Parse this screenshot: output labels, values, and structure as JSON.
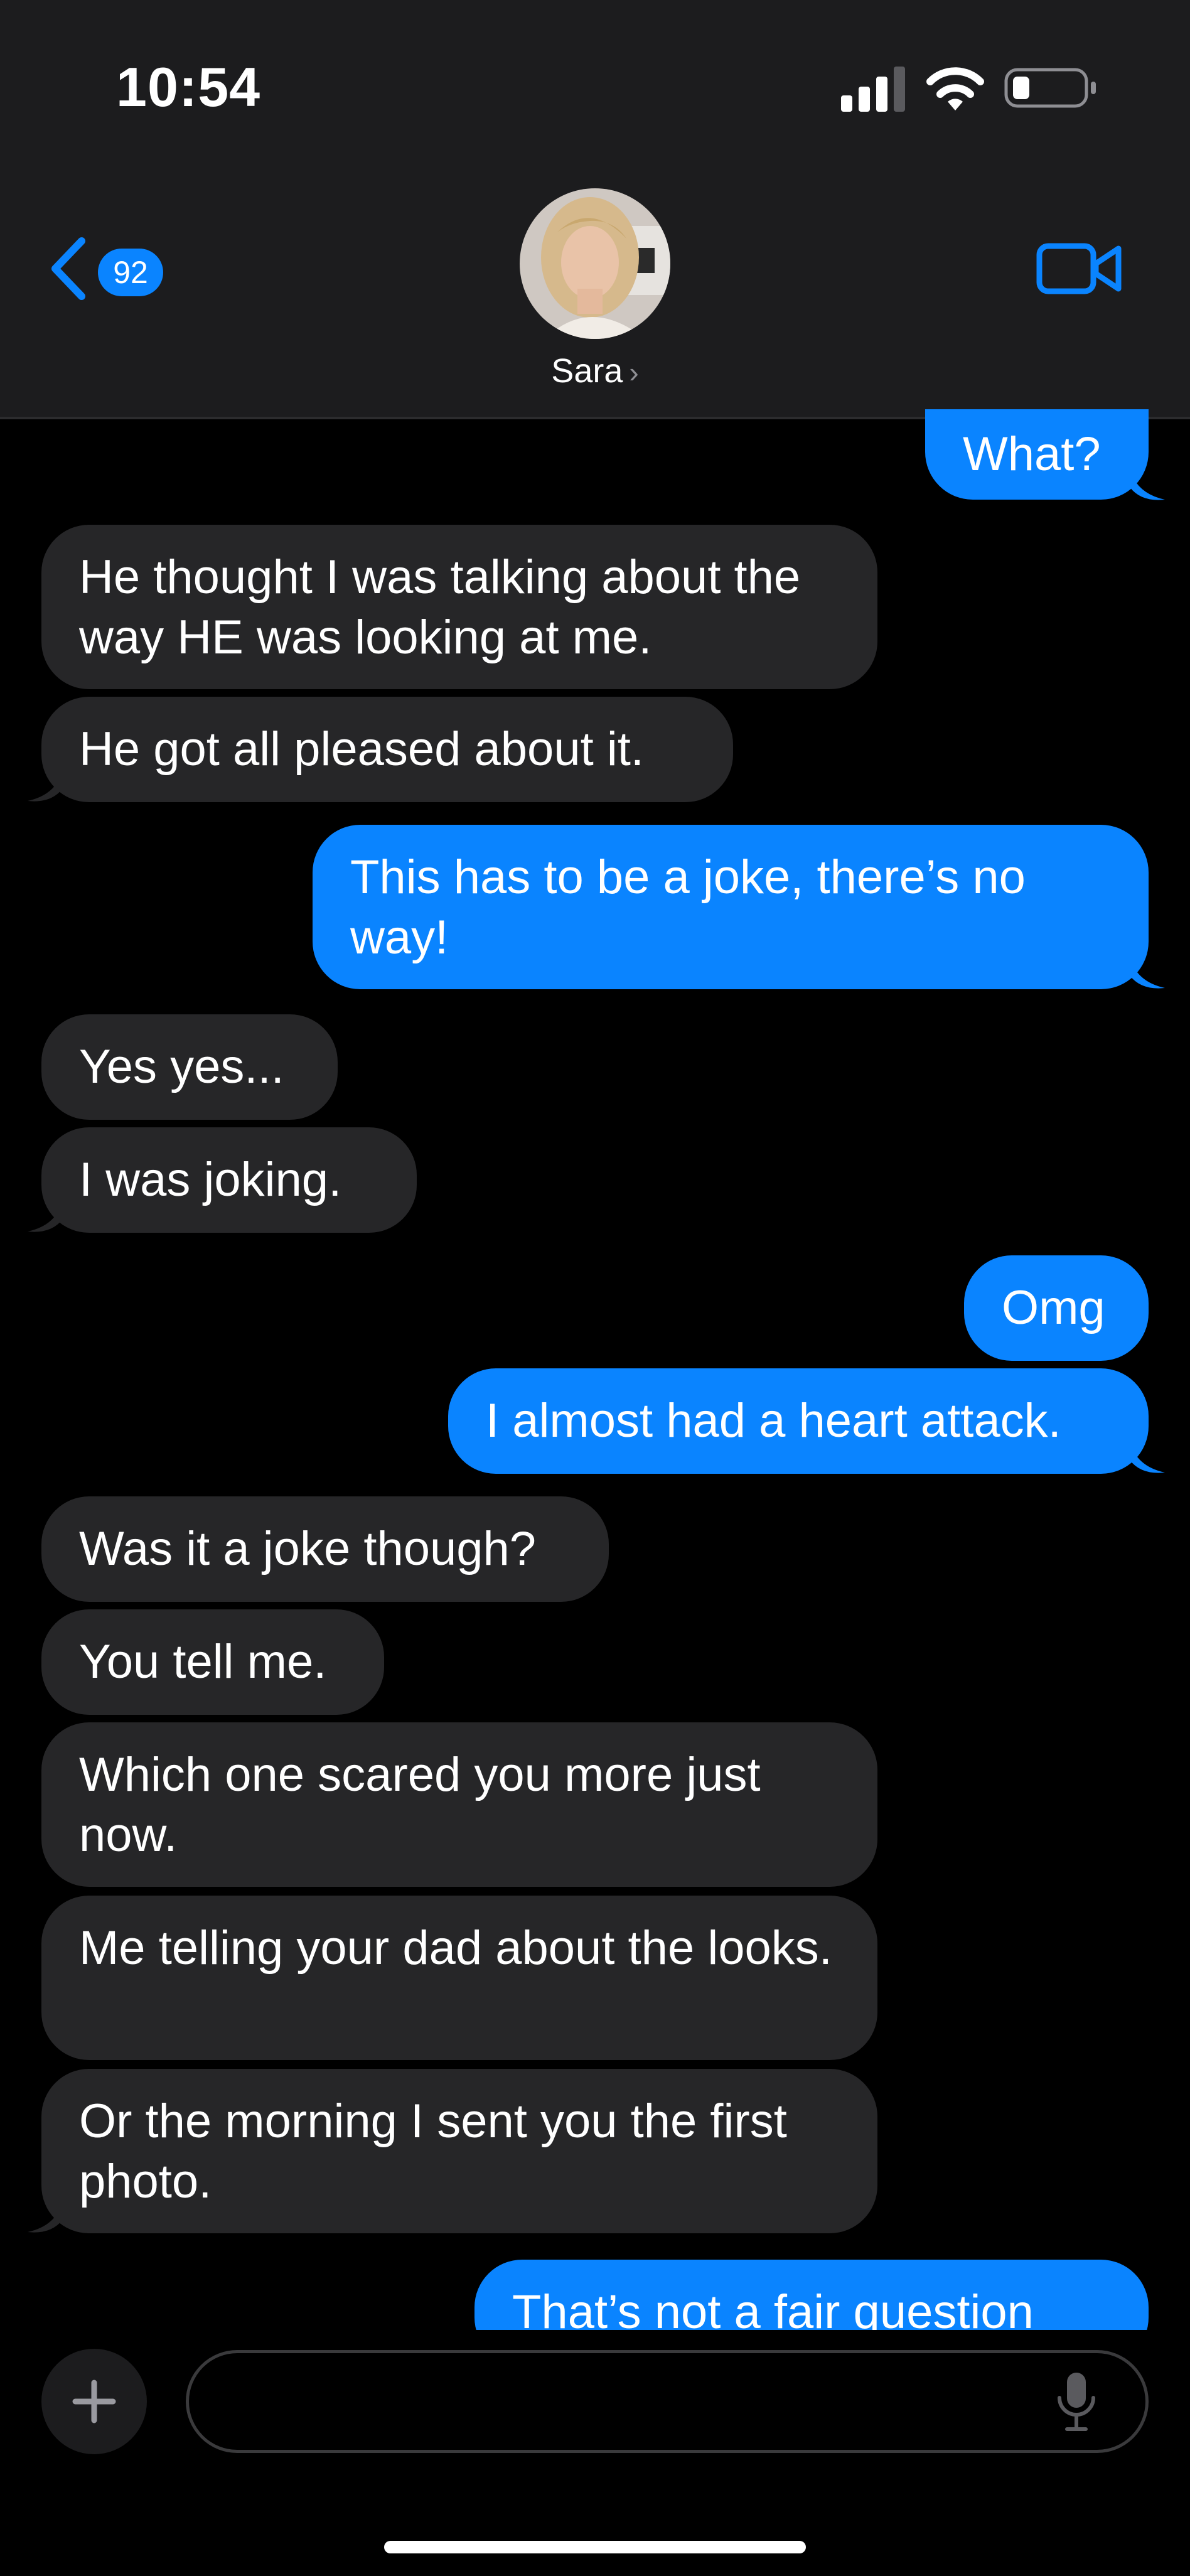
{
  "status_bar": {
    "time": "10:54"
  },
  "nav": {
    "back_badge": "92",
    "contact_name": "Sara",
    "contact_chevron": "›"
  },
  "messages": [
    {
      "direction": "outgoing",
      "text": "What?"
    },
    {
      "direction": "incoming",
      "text": "He thought I was talking about the way HE was looking at me."
    },
    {
      "direction": "incoming",
      "text": "He got all pleased about it."
    },
    {
      "direction": "outgoing",
      "text": "This has to be a joke, there’s no way!"
    },
    {
      "direction": "incoming",
      "text": "Yes yes..."
    },
    {
      "direction": "incoming",
      "text": "I was joking."
    },
    {
      "direction": "outgoing",
      "text": "Omg"
    },
    {
      "direction": "outgoing",
      "text": "I almost had a heart attack."
    },
    {
      "direction": "incoming",
      "text": "Was it a joke though?"
    },
    {
      "direction": "incoming",
      "text": "You tell me."
    },
    {
      "direction": "incoming",
      "text": "Which one scared you more just now."
    },
    {
      "direction": "incoming",
      "text": "Me telling your dad about the looks."
    },
    {
      "direction": "incoming",
      "text": "Or the morning I sent you the first photo."
    },
    {
      "direction": "outgoing",
      "text": "That’s not a fair question"
    }
  ],
  "icons": {
    "back": "chevron-left-icon",
    "video": "video-camera-icon",
    "plus": "plus-icon",
    "mic": "microphone-icon"
  },
  "colors": {
    "outgoing_bubble": "#0a84ff",
    "incoming_bubble": "#262628",
    "background": "#000000",
    "header": "#1c1c1e"
  }
}
